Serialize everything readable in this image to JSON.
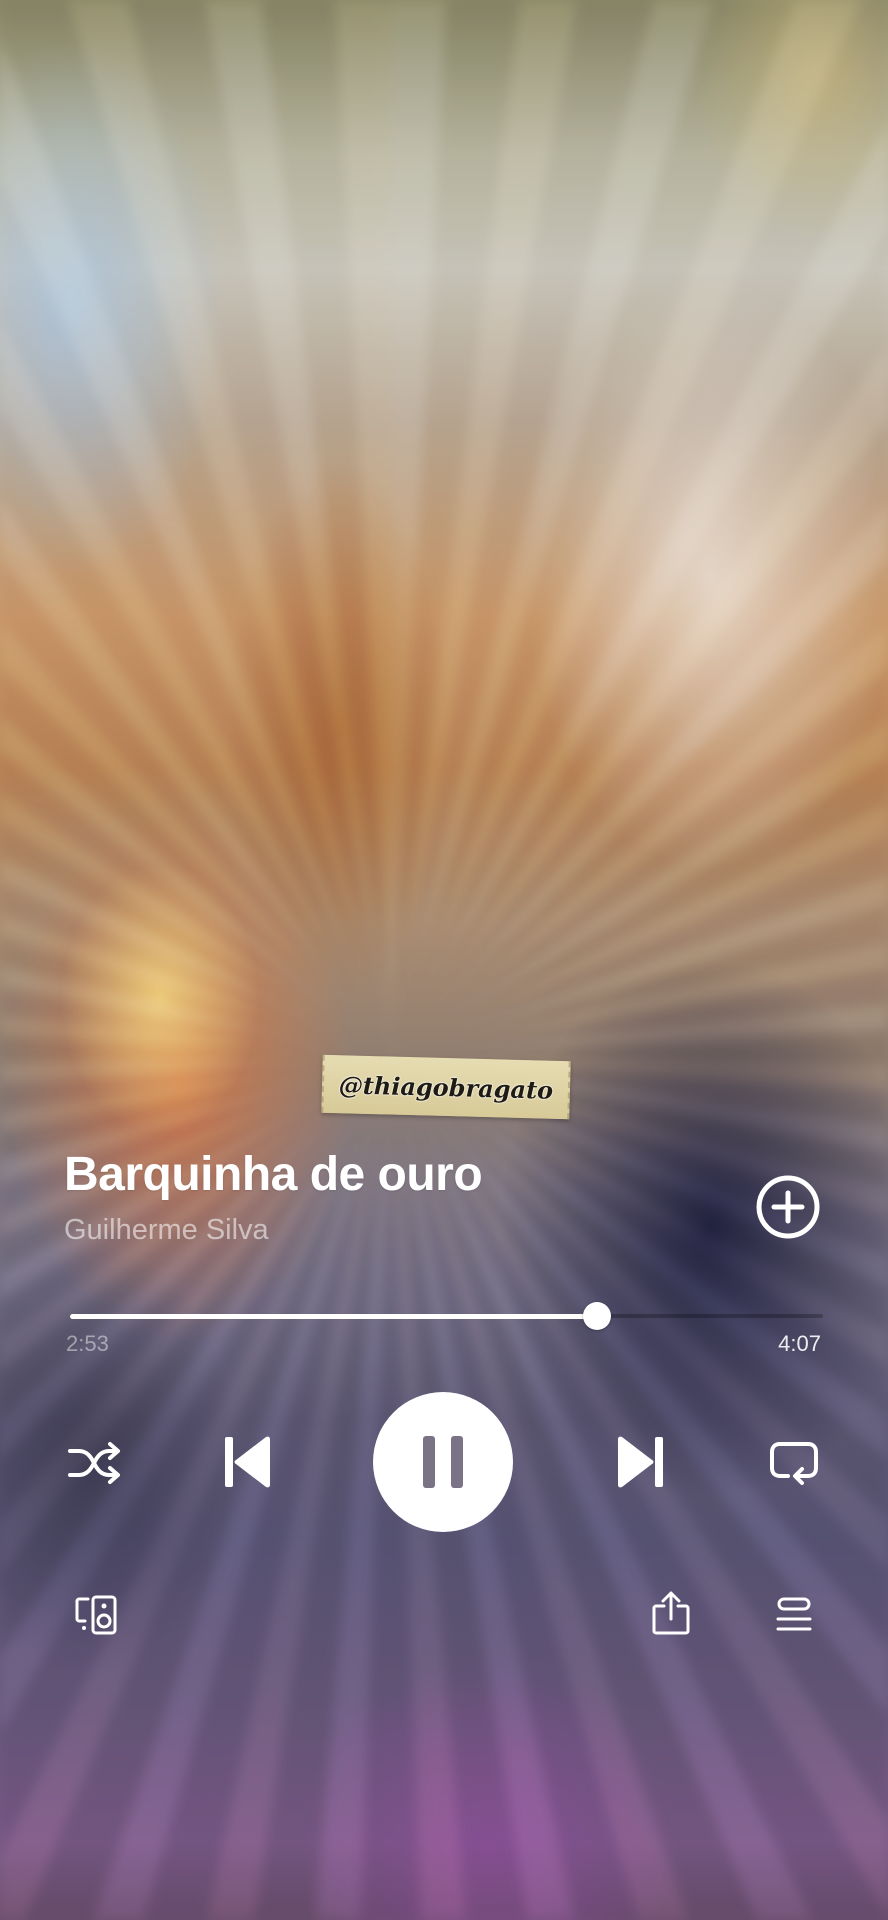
{
  "watermark": {
    "text": "@thiagobragato"
  },
  "track": {
    "title": "Barquinha de ouro",
    "artist": "Guilherme Silva"
  },
  "progress": {
    "elapsed": "2:53",
    "total": "4:07",
    "fraction": 0.6996
  },
  "player": {
    "state": "playing",
    "accent": "#ffffff"
  },
  "icons": {
    "add": "plus-circle-icon",
    "shuffle": "shuffle-icon",
    "previous": "skip-previous-icon",
    "pause": "pause-icon",
    "next": "skip-next-icon",
    "repeat": "repeat-icon",
    "devices": "connect-devices-icon",
    "share": "share-icon",
    "queue": "queue-icon"
  }
}
